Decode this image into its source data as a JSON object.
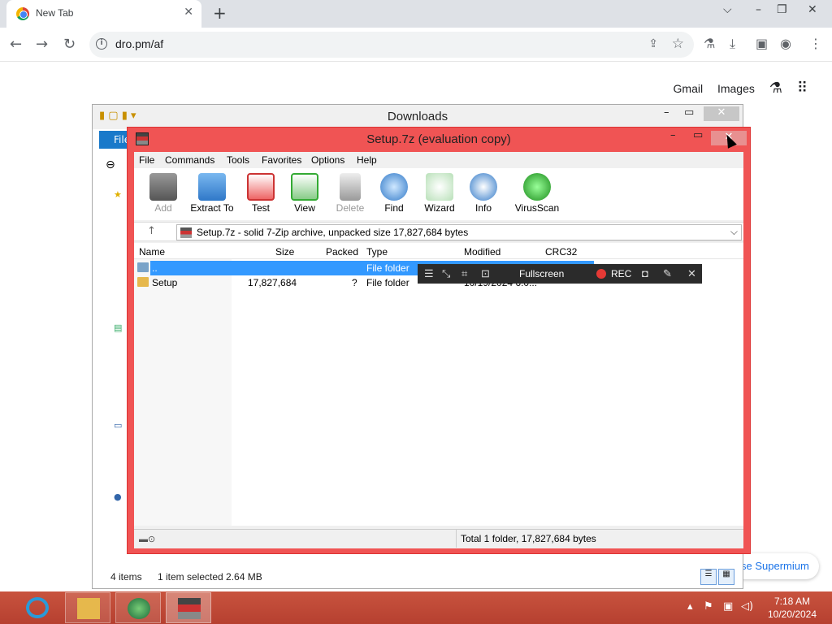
{
  "browser": {
    "tab_title": "New Tab",
    "url": "dro.pm/af",
    "ntp_links": [
      "Gmail",
      "Images"
    ],
    "promo_text": "se Supermium"
  },
  "explorer": {
    "title": "Downloads",
    "ribbon_file": "File",
    "status_items": "4 items",
    "status_selected": "1 item selected  2.64 MB"
  },
  "sevenzip": {
    "title": "Setup.7z (evaluation copy)",
    "menu": [
      "File",
      "Commands",
      "Tools",
      "Favorites",
      "Options",
      "Help"
    ],
    "tools": [
      "Add",
      "Extract To",
      "Test",
      "View",
      "Delete",
      "Find",
      "Wizard",
      "Info",
      "VirusScan"
    ],
    "address": "Setup.7z - solid 7-Zip archive, unpacked size 17,827,684 bytes",
    "columns": [
      "Name",
      "Size",
      "Packed",
      "Type",
      "Modified",
      "CRC32"
    ],
    "rows": [
      {
        "name": "..",
        "size": "",
        "packed": "",
        "type": "File folder",
        "modified": ""
      },
      {
        "name": "Setup",
        "size": "17,827,684",
        "packed": "?",
        "type": "File folder",
        "modified": "10/19/2024 6:0..."
      }
    ],
    "status": "Total 1 folder, 17,827,684 bytes"
  },
  "recorder": {
    "fullscreen_label": "Fullscreen",
    "rec_label": "REC"
  },
  "taskbar": {
    "time": "7:18 AM",
    "date": "10/20/2024"
  },
  "colors": {
    "zip_frame": "#f05454",
    "selection": "#3399ff",
    "taskbar": "#b64030",
    "ribbon": "#1979ca"
  }
}
